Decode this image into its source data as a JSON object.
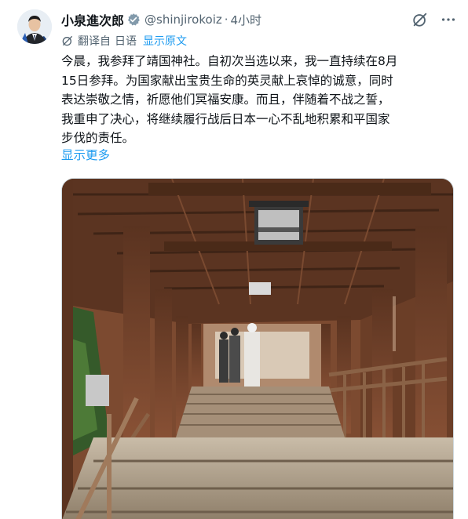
{
  "author": {
    "name": "小泉進次郎",
    "handle": "@shinjirokoiz",
    "separator": "·",
    "time": "4小时",
    "avatar_icon": "person-avatar-icon",
    "verified_icon": "verified-badge-icon"
  },
  "header_actions": {
    "grok_icon": "slashed-circle-icon",
    "more_icon": "more-dots-icon"
  },
  "translation": {
    "icon": "translate-icon",
    "label": "翻译自",
    "source_language": "日语",
    "show_original": "显示原文"
  },
  "post": {
    "lines": [
      "今晨，我参拜了靖国神社。自初次当选以来，我一直持续在8月",
      "15日参拜。为国家献出宝贵生命的英灵献上哀悼的诚意，同时",
      "表达崇敬之情，祈愿他们冥福安康。而且，伴随着不战之誓，",
      "我重申了决心，将继续履行战后日本一心不乱地积累和平国家",
      "步伐的责任。"
    ],
    "show_more": "显示更多"
  },
  "media": {
    "type": "photo"
  },
  "colors": {
    "text": "#0f1419",
    "secondary": "#536471",
    "link": "#1d9bf0",
    "verified": "#829aab"
  }
}
